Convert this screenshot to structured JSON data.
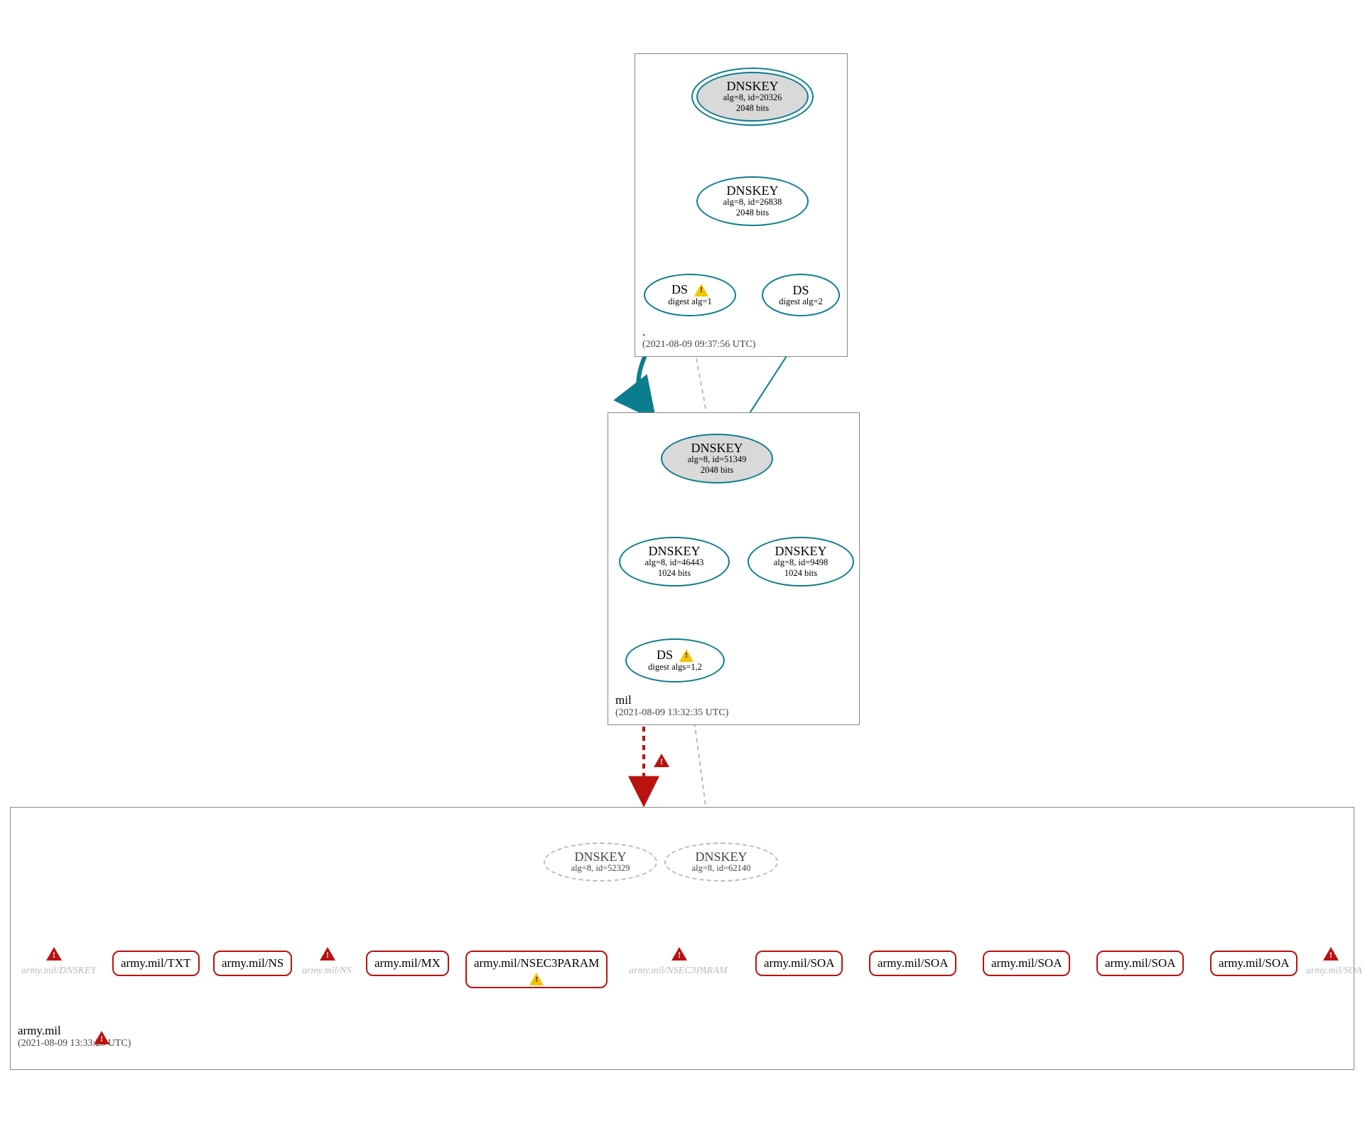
{
  "zones": {
    "root": {
      "name": ".",
      "time": "(2021-08-09 09:37:56 UTC)"
    },
    "mil": {
      "name": "mil",
      "time": "(2021-08-09 13:32:35 UTC)"
    },
    "army": {
      "name": "army.mil",
      "time": "(2021-08-09 13:33:28 UTC)"
    }
  },
  "nodes": {
    "root_ksk": {
      "title": "DNSKEY",
      "sub1": "alg=8, id=20326",
      "sub2": "2048 bits"
    },
    "root_zsk": {
      "title": "DNSKEY",
      "sub1": "alg=8, id=26838",
      "sub2": "2048 bits"
    },
    "root_ds1": {
      "title": "DS",
      "sub1": "digest alg=1"
    },
    "root_ds2": {
      "title": "DS",
      "sub1": "digest alg=2"
    },
    "mil_ksk": {
      "title": "DNSKEY",
      "sub1": "alg=8, id=51349",
      "sub2": "2048 bits"
    },
    "mil_zsk1": {
      "title": "DNSKEY",
      "sub1": "alg=8, id=46443",
      "sub2": "1024 bits"
    },
    "mil_zsk2": {
      "title": "DNSKEY",
      "sub1": "alg=8, id=9498",
      "sub2": "1024 bits"
    },
    "mil_ds": {
      "title": "DS",
      "sub1": "digest algs=1,2"
    },
    "army_k1": {
      "title": "DNSKEY",
      "sub1": "alg=8, id=52329"
    },
    "army_k2": {
      "title": "DNSKEY",
      "sub1": "alg=8, id=62140"
    }
  },
  "records": {
    "txt": "army.mil/TXT",
    "ns": "army.mil/NS",
    "mx": "army.mil/MX",
    "nsec": "army.mil/NSEC3PARAM",
    "soa": "army.mil/SOA"
  },
  "ghosts": {
    "dnskey": "army.mil/DNSKEY",
    "ns": "army.mil/NS",
    "nsec": "army.mil/NSEC3PARAM",
    "soa": "army.mil/SOA"
  }
}
